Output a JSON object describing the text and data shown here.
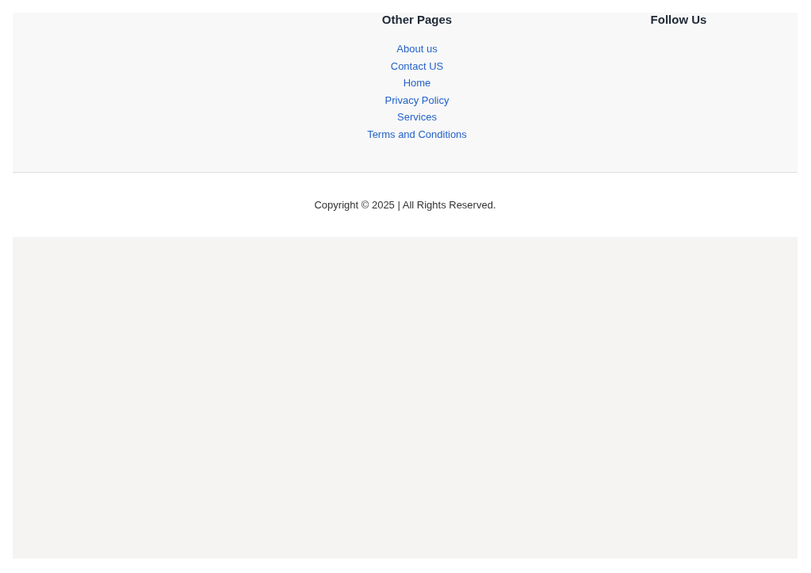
{
  "footer": {
    "columns": [
      {
        "heading": "Other Pages",
        "links": [
          "About us",
          "Contact US",
          "Home",
          "Privacy Policy",
          "Services",
          "Terms and Conditions"
        ]
      },
      {
        "heading": "Follow Us"
      }
    ]
  },
  "copyright": "Copyright © 2025 |  All Rights Reserved."
}
